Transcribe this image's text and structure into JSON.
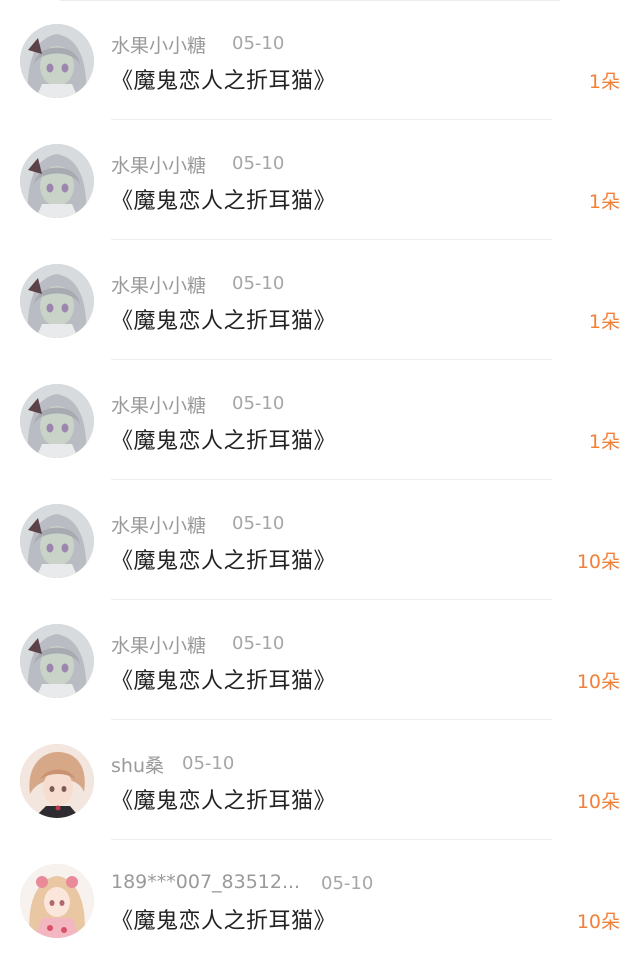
{
  "gifts": [
    {
      "user": "水果小小糖",
      "time": "05-10",
      "title": "《魔鬼恋人之折耳猫》",
      "amount": "1朵",
      "avatar": "silver-hair-girl-avatar"
    },
    {
      "user": "水果小小糖",
      "time": "05-10",
      "title": "《魔鬼恋人之折耳猫》",
      "amount": "1朵",
      "avatar": "silver-hair-girl-avatar"
    },
    {
      "user": "水果小小糖",
      "time": "05-10",
      "title": "《魔鬼恋人之折耳猫》",
      "amount": "1朵",
      "avatar": "silver-hair-girl-avatar"
    },
    {
      "user": "水果小小糖",
      "time": "05-10",
      "title": "《魔鬼恋人之折耳猫》",
      "amount": "1朵",
      "avatar": "silver-hair-girl-avatar"
    },
    {
      "user": "水果小小糖",
      "time": "05-10",
      "title": "《魔鬼恋人之折耳猫》",
      "amount": "10朵",
      "avatar": "silver-hair-girl-avatar"
    },
    {
      "user": "水果小小糖",
      "time": "05-10",
      "title": "《魔鬼恋人之折耳猫》",
      "amount": "10朵",
      "avatar": "silver-hair-girl-avatar"
    },
    {
      "user": "shu桑",
      "time": "05-10",
      "title": "《魔鬼恋人之折耳猫》",
      "amount": "10朵",
      "avatar": "blonde-boy-avatar"
    },
    {
      "user": "189***007_83512...",
      "time": "05-10",
      "title": "《魔鬼恋人之折耳猫》",
      "amount": "10朵",
      "avatar": "kimono-girl-avatar"
    }
  ],
  "colors": {
    "amount": "#f0803a",
    "username": "#9a9a9a",
    "title": "#222222"
  }
}
